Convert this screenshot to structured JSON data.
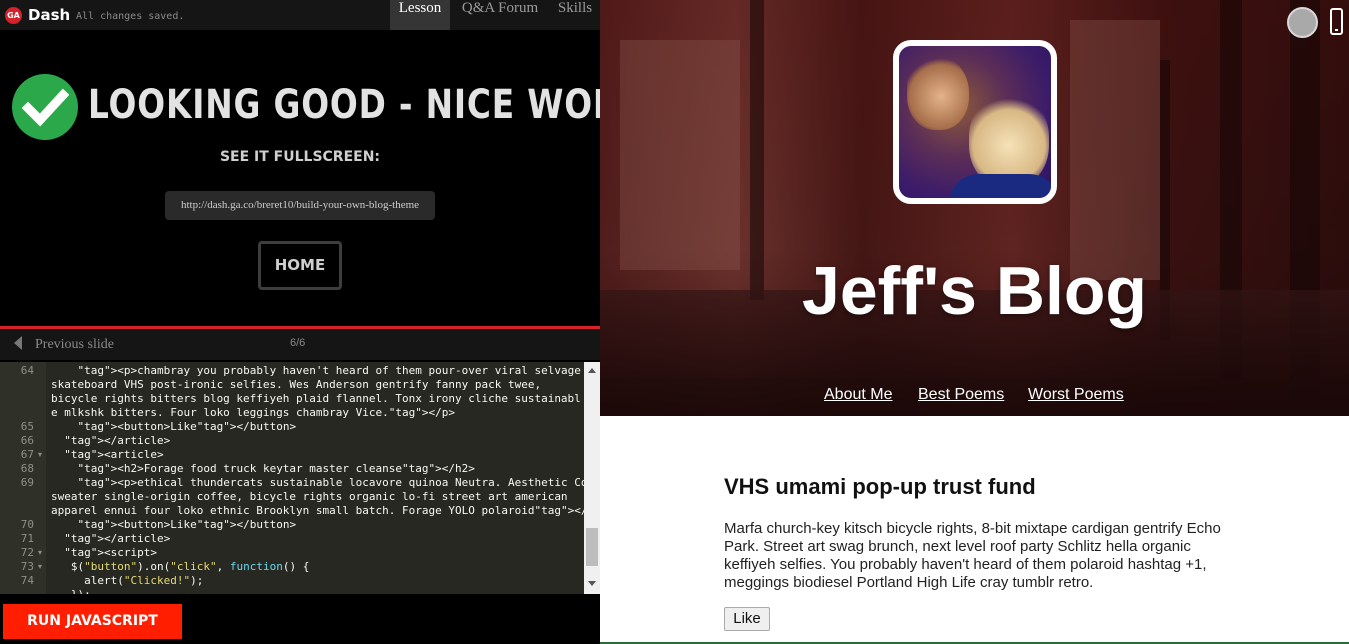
{
  "app": {
    "logo": "GA",
    "name": "Dash",
    "save_status": "All changes saved."
  },
  "nav_tabs": [
    {
      "label": "Lesson",
      "active": true
    },
    {
      "label": "Q&A Forum",
      "active": false
    },
    {
      "label": "Skills",
      "active": false
    }
  ],
  "lesson": {
    "headline": "LOOKING GOOD - NICE WORK!",
    "see_fullscreen": "SEE IT FULLSCREEN:",
    "url": "http://dash.ga.co/breret10/build-your-own-blog-theme",
    "home_label": "HOME",
    "check_icon": "checkmark-icon"
  },
  "slide_nav": {
    "previous_label": "Previous slide",
    "counter": "6/6"
  },
  "editor": {
    "lines": [
      {
        "num": "64",
        "fold": "",
        "text": "    <p>chambray you probably haven't heard of them pour-over viral selvage umami"
      },
      {
        "num": "",
        "fold": "",
        "text": "skateboard VHS post-ironic selfies. Wes Anderson gentrify fanny pack twee,"
      },
      {
        "num": "",
        "fold": "",
        "text": "bicycle rights bitters blog keffiyeh plaid flannel. Tonx irony cliche sustainabl"
      },
      {
        "num": "",
        "fold": "",
        "text": "e mlkshk bitters. Four loko leggings chambray Vice.</p>"
      },
      {
        "num": "65",
        "fold": "",
        "text": "    <button>Like</button>"
      },
      {
        "num": "66",
        "fold": "",
        "text": "  </article>"
      },
      {
        "num": "67",
        "fold": "▾",
        "text": "  <article>"
      },
      {
        "num": "68",
        "fold": "",
        "text": "    <h2>Forage food truck keytar master cleanse</h2>"
      },
      {
        "num": "69",
        "fold": "",
        "text": "    <p>ethical thundercats sustainable locavore quinoa Neutra. Aesthetic Cosby"
      },
      {
        "num": "",
        "fold": "",
        "text": "sweater single-origin coffee, bicycle rights organic lo-fi street art american"
      },
      {
        "num": "",
        "fold": "",
        "text": "apparel ennui four loko ethnic Brooklyn small batch. Forage YOLO polaroid</p>"
      },
      {
        "num": "70",
        "fold": "",
        "text": "    <button>Like</button>"
      },
      {
        "num": "71",
        "fold": "",
        "text": "  </article>"
      },
      {
        "num": "72",
        "fold": "▾",
        "text": "  <script>"
      },
      {
        "num": "73",
        "fold": "▾",
        "text": "   $(\"button\").on(\"click\", function() {"
      },
      {
        "num": "74",
        "fold": "",
        "text": "     alert(\"Clicked!\");"
      },
      {
        "num": "",
        "fold": "",
        "text": "   });"
      }
    ]
  },
  "run_label": "RUN JAVASCRIPT",
  "preview": {
    "blog_title": "Jeff's Blog",
    "nav": [
      "About Me",
      "Best Poems",
      "Worst Poems"
    ],
    "post_title": "VHS umami pop-up trust fund",
    "post_body": "Marfa church-key kitsch bicycle rights, 8-bit mixtape cardigan gentrify Echo Park. Street art swag brunch, next level roof party Schlitz hella organic keffiyeh selfies. You probably haven't heard of them polaroid hashtag +1, meggings biodiesel Portland High Life cray tumblr retro.",
    "like_label": "Like"
  },
  "colors": {
    "accent_red": "#d6202a",
    "run_button": "#ff1e00",
    "check_green": "#2aa84a"
  }
}
